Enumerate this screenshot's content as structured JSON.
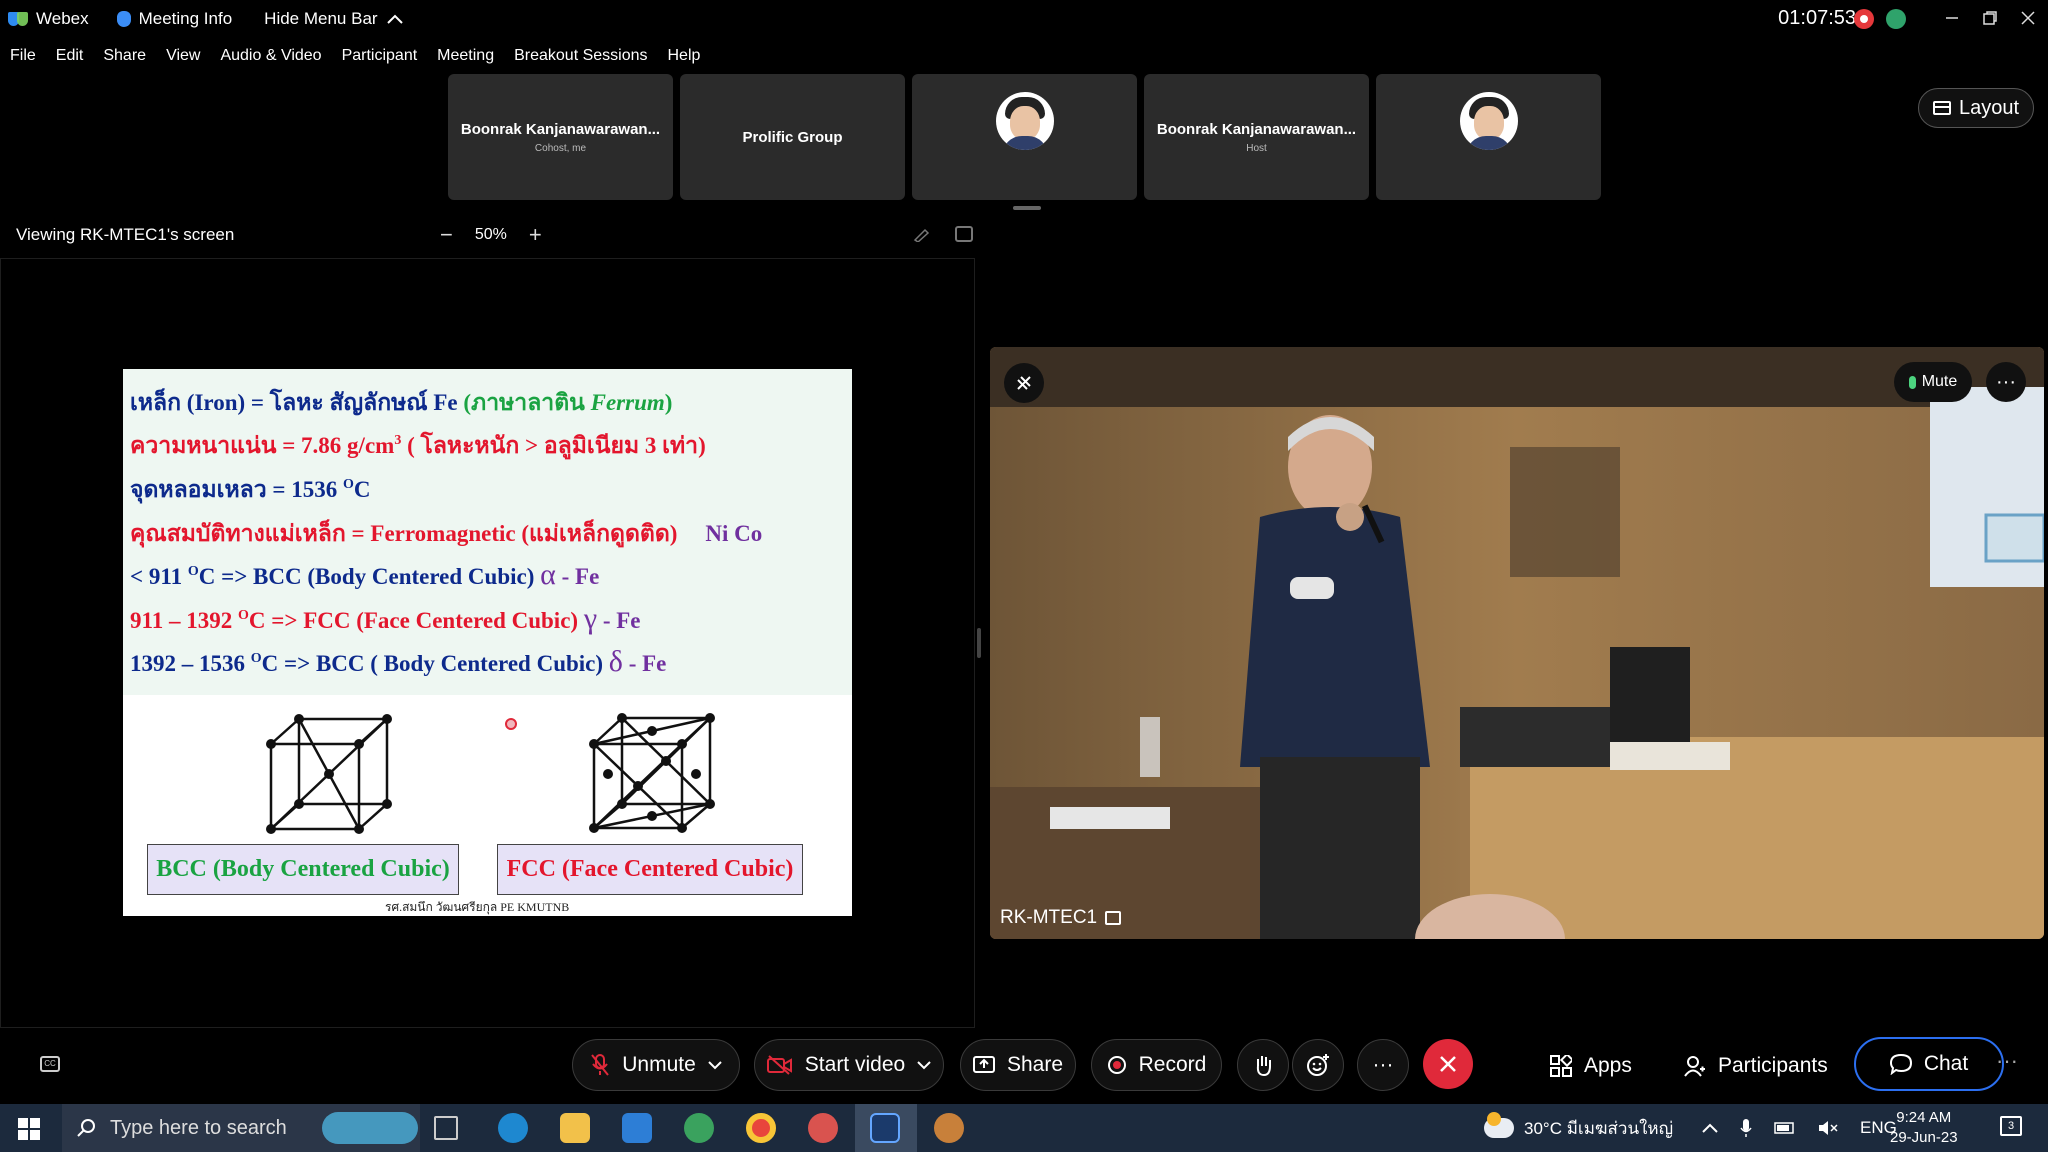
{
  "titlebar": {
    "app_name": "Webex",
    "meeting_info": "Meeting Info",
    "hide_menu": "Hide Menu Bar",
    "timer": "01:07:53"
  },
  "menu": [
    "File",
    "Edit",
    "Share",
    "View",
    "Audio & Video",
    "Participant",
    "Meeting",
    "Breakout Sessions",
    "Help"
  ],
  "participants": [
    {
      "name": "Boonrak Kanjanawarawan...",
      "role": "Cohost, me"
    },
    {
      "name": "Prolific Group",
      "role": ""
    },
    {
      "name": "",
      "role": ""
    },
    {
      "name": "Boonrak Kanjanawarawan...",
      "role": "Host"
    },
    {
      "name": "",
      "role": ""
    }
  ],
  "layout_label": "Layout",
  "viewing": {
    "label": "Viewing RK-MTEC1's screen",
    "zoom": "50%",
    "minus": "−",
    "plus": "+"
  },
  "slide": {
    "l1a": "เหล็ก (Iron)  = โลหะ สัญลักษณ์  Fe ",
    "l1b": "(ภาษาลาติน ",
    "l1c": "Ferrum",
    "l1d": ")",
    "l2a": "ความหนาแน่น = 7.86  g/cm",
    "l2sup": "3",
    "l2b": " ( โลหะหนัก > อลูมิเนียม 3 เท่า)",
    "l3a": "จุดหลอมเหลว = 1536 ",
    "l3sup": "O",
    "l3b": "C",
    "l4a": "คุณสมบัติทางแม่เหล็ก = Ferromagnetic (แม่เหล็กดูดติด)",
    "l4b": "Ni  Co",
    "l5a": "< 911 ",
    "l5sup": "O",
    "l5b": "C => BCC (Body Centered Cubic) ",
    "l5g": "α",
    "l5c": " - Fe",
    "l6a": "911 – 1392 ",
    "l6sup": "O",
    "l6b": "C => FCC (Face Centered Cubic) ",
    "l6g": "γ",
    "l6c": " - Fe",
    "l7a": "1392 – 1536 ",
    "l7sup": "O",
    "l7b": "C => BCC ( Body Centered Cubic) ",
    "l7g": "δ",
    "l7c": " - Fe",
    "bcc_label": "BCC (Body Centered Cubic)",
    "fcc_label": "FCC (Face Centered Cubic)",
    "credit": "รศ.สมนึก  วัฒนศรียกุล  PE   KMUTNB"
  },
  "video": {
    "label": "RK-MTEC1",
    "mute": "Mute",
    "more": "···"
  },
  "controls": {
    "unmute": "Unmute",
    "start_video": "Start video",
    "share": "Share",
    "record": "Record",
    "more": "···",
    "apps": "Apps",
    "participants": "Participants",
    "chat": "Chat"
  },
  "taskbar": {
    "search_placeholder": "Type here to search",
    "weather": "30°C  มีเมฆส่วนใหญ่",
    "lang": "ENG",
    "time": "9:24 AM",
    "date": "29-Jun-23",
    "notif_count": "3"
  },
  "colors": {
    "accent_blue": "#2c6ff0",
    "end_red": "#e0293a",
    "slide_navy": "#0d2a8c",
    "slide_red": "#e3162d",
    "slide_green": "#1aa342"
  }
}
